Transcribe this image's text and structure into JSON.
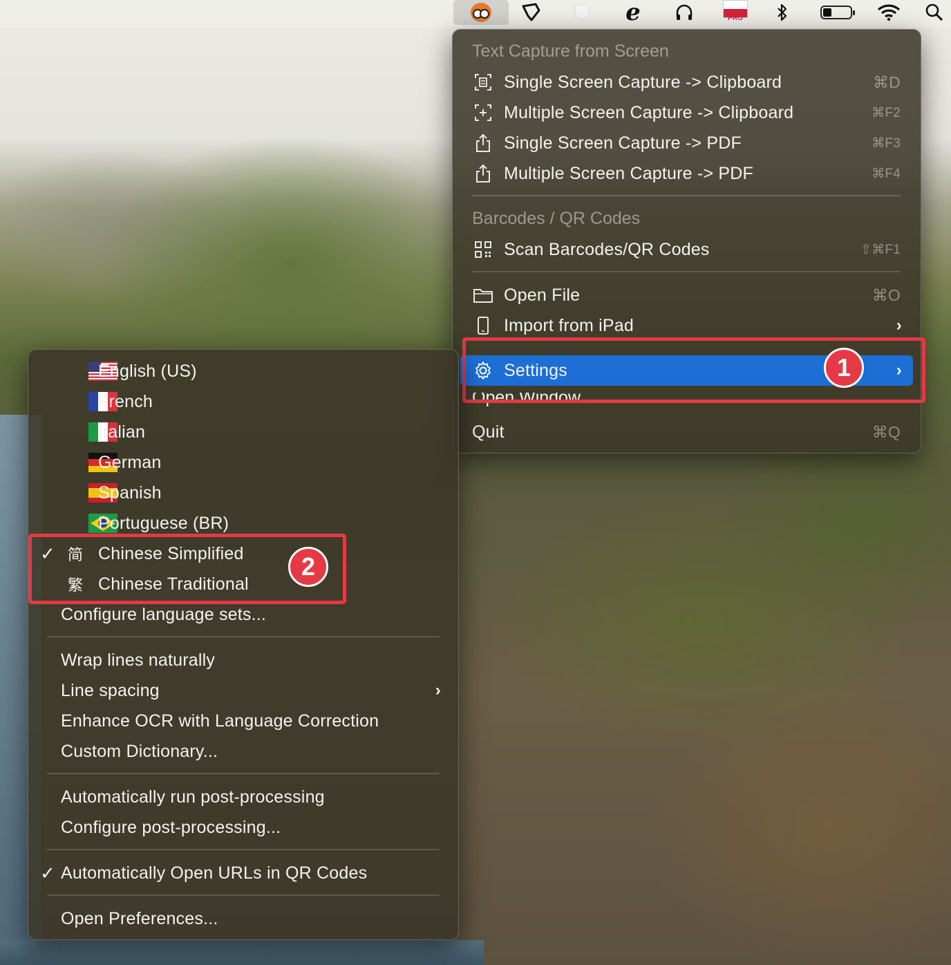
{
  "menubar": {
    "items": [
      {
        "icon": "owl-app-icon"
      },
      {
        "icon": "paw-icon"
      },
      {
        "icon": "bird-icon"
      },
      {
        "icon": "e-icon"
      },
      {
        "icon": "headphones-icon"
      },
      {
        "icon": "poland-flag-icon",
        "label": "PRO"
      },
      {
        "icon": "bluetooth-icon"
      },
      {
        "icon": "battery-icon"
      },
      {
        "icon": "wifi-icon"
      },
      {
        "icon": "search-icon"
      }
    ]
  },
  "main_menu": {
    "section_text_capture": "Text Capture from Screen",
    "items_capture": [
      {
        "label": "Single Screen Capture -> Clipboard",
        "shortcut": "⌘D",
        "icon": "screen-capture-icon"
      },
      {
        "label": "Multiple Screen Capture -> Clipboard",
        "shortcut": "⌘F2",
        "icon": "multi-capture-icon"
      },
      {
        "label": "Single Screen Capture -> PDF",
        "shortcut": "⌘F3",
        "icon": "share-icon"
      },
      {
        "label": "Multiple Screen Capture -> PDF",
        "shortcut": "⌘F4",
        "icon": "share-icon"
      }
    ],
    "section_barcodes": "Barcodes / QR Codes",
    "scan": {
      "label": "Scan Barcodes/QR Codes",
      "shortcut": "⇧⌘F1",
      "icon": "qr-code-icon"
    },
    "open_file": {
      "label": "Open File",
      "shortcut": "⌘O",
      "icon": "folder-icon"
    },
    "import_ipad": {
      "label": "Import from iPad",
      "icon": "ipad-icon"
    },
    "settings": {
      "label": "Settings",
      "icon": "gear-icon"
    },
    "open_window": "Open Window",
    "quit": {
      "label": "Quit",
      "shortcut": "⌘Q"
    }
  },
  "settings_menu": {
    "languages": [
      {
        "label": "English (US)",
        "flag": "us-flag-icon"
      },
      {
        "label": "French",
        "flag": "france-flag-icon"
      },
      {
        "label": "Italian",
        "flag": "italy-flag-icon"
      },
      {
        "label": "German",
        "flag": "germany-flag-icon"
      },
      {
        "label": "Spanish",
        "flag": "spain-flag-icon"
      },
      {
        "label": "Portuguese (BR)",
        "flag": "brazil-flag-icon"
      },
      {
        "label": "Chinese Simplified",
        "glyph": "简",
        "checked": true
      },
      {
        "label": "Chinese Traditional",
        "glyph": "繁",
        "checked": false
      }
    ],
    "configure_language_sets": "Configure language sets...",
    "wrap_lines": "Wrap lines naturally",
    "line_spacing": "Line spacing",
    "enhance_ocr": "Enhance OCR with Language Correction",
    "custom_dictionary": "Custom Dictionary...",
    "auto_post": "Automatically run post-processing",
    "configure_post": "Configure post-processing...",
    "auto_open_urls": "Automatically Open URLs in QR Codes",
    "open_preferences": "Open Preferences..."
  },
  "callouts": {
    "one": "1",
    "two": "2"
  },
  "colors": {
    "highlight": "#1d6fd6",
    "callout": "#e53945"
  }
}
